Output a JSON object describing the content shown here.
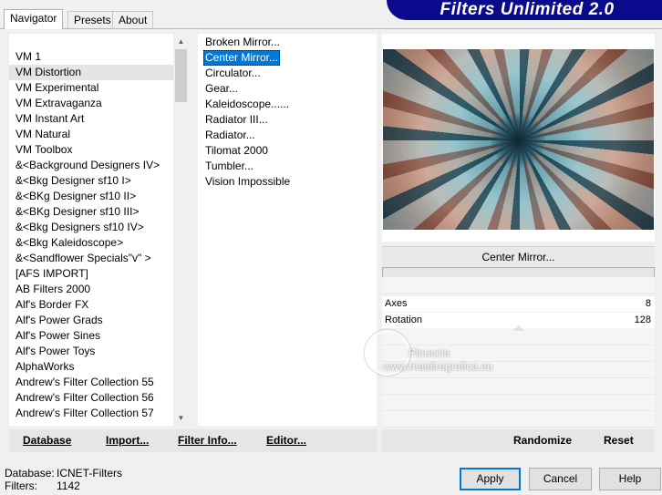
{
  "tabs": [
    "Navigator",
    "Presets",
    "About"
  ],
  "app_title": "Filters Unlimited 2.0",
  "categories": [
    "VM 1",
    "VM Distortion",
    "VM Experimental",
    "VM Extravaganza",
    "VM Instant Art",
    "VM Natural",
    "VM Toolbox",
    "&<Background Designers IV>",
    "&<Bkg Designer sf10 I>",
    "&<BKg Designer sf10 II>",
    "&<BKg Designer sf10 III>",
    "&<Bkg Designers sf10 IV>",
    "&<Bkg Kaleidoscope>",
    "&<Sandflower Specials\"v\" >",
    "[AFS IMPORT]",
    "AB Filters 2000",
    "Alf's Border FX",
    "Alf's Power Grads",
    "Alf's Power Sines",
    "Alf's Power Toys",
    "AlphaWorks",
    "Andrew's Filter Collection 55",
    "Andrew's Filter Collection 56",
    "Andrew's Filter Collection 57"
  ],
  "selected_category": "VM Distortion",
  "filters": [
    "Broken Mirror...",
    "Center Mirror...",
    "Circulator...",
    "Gear...",
    "Kaleidoscope......",
    "Radiator III...",
    "Radiator...",
    "Tilomat 2000",
    "Tumbler...",
    "Vision Impossible"
  ],
  "selected_filter": "Center Mirror...",
  "filter_title": "Center Mirror...",
  "params": [
    {
      "name": "Axes",
      "value": "8"
    },
    {
      "name": "Rotation",
      "value": "128"
    }
  ],
  "toolbar_left": {
    "database": "Database",
    "import": "Import...",
    "filter_info": "Filter Info...",
    "editor": "Editor..."
  },
  "toolbar_right": {
    "randomize": "Randomize",
    "reset": "Reset"
  },
  "footer": {
    "database_label": "Database:",
    "database_value": "ICNET-Filters",
    "filters_label": "Filters:",
    "filters_value": "1142"
  },
  "buttons": {
    "apply": "Apply",
    "cancel": "Cancel",
    "help": "Help"
  },
  "watermark": {
    "line1": "Pinuccia",
    "line2": "www.maidiregrafica.eu"
  }
}
